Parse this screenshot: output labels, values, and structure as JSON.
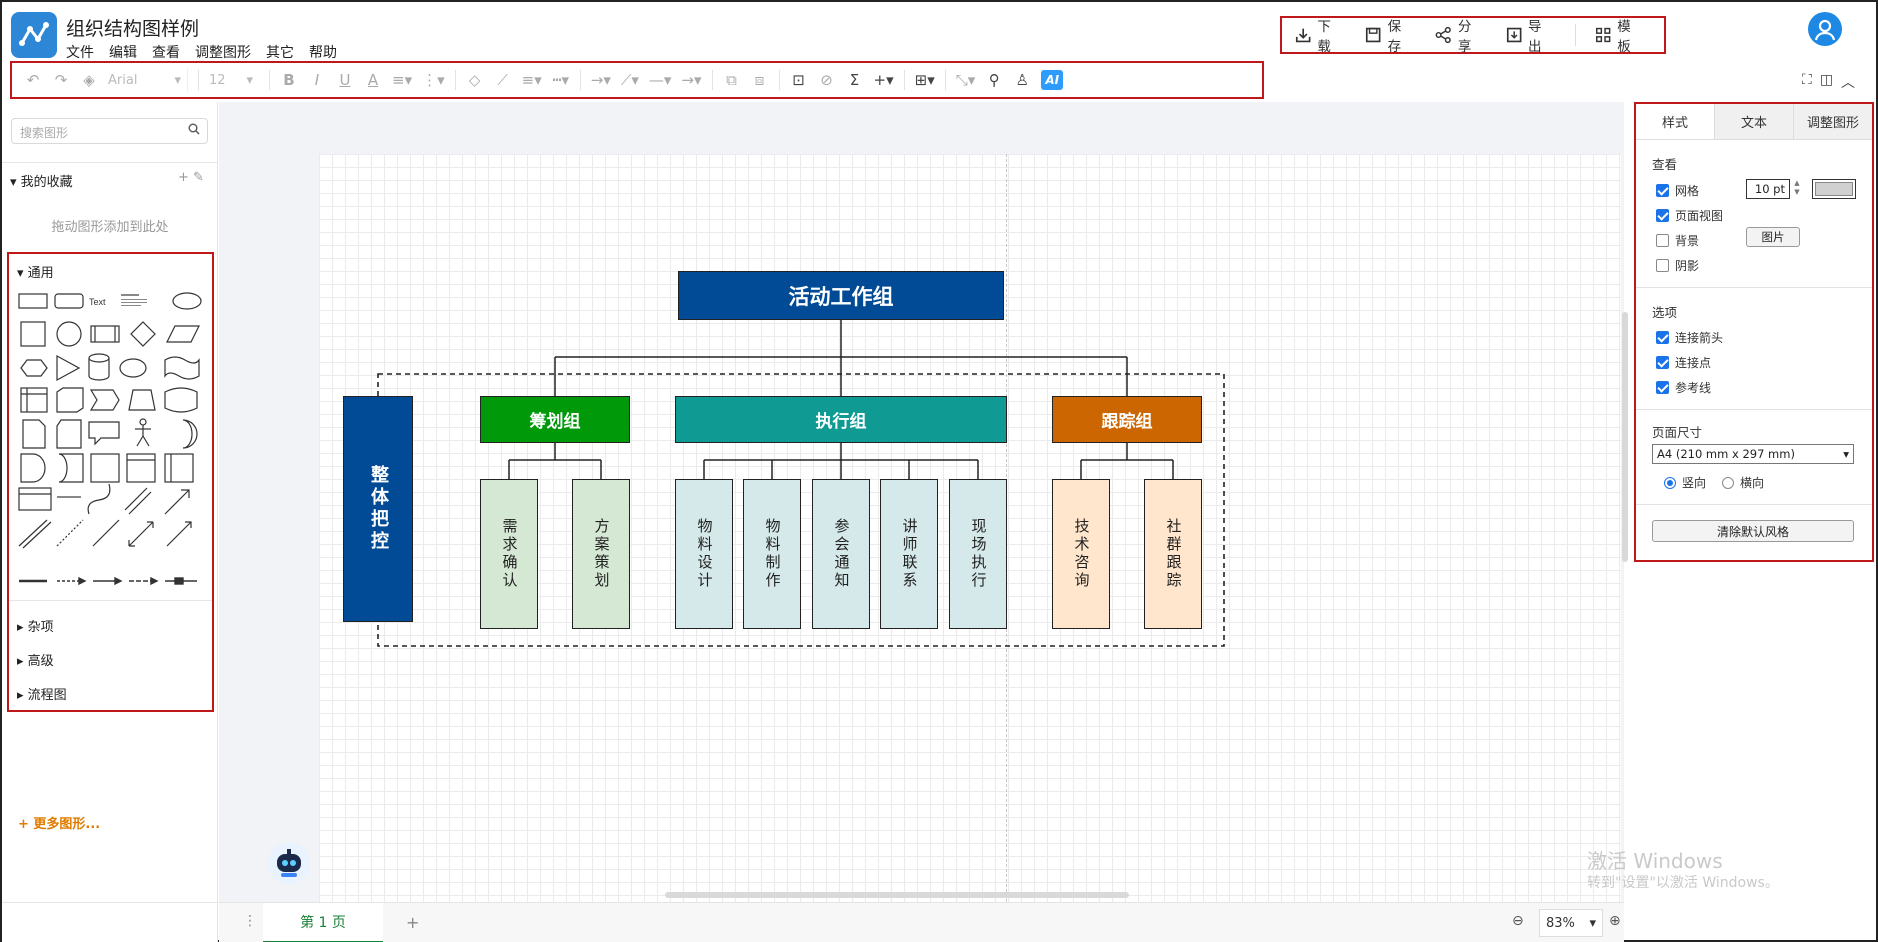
{
  "app": {
    "title": "组织结构图样例",
    "menu": [
      "文件",
      "编辑",
      "查看",
      "调整图形",
      "其它",
      "帮助"
    ]
  },
  "actions": {
    "download": "下载",
    "save": "保存",
    "share": "分享",
    "export": "导出",
    "template": "模板"
  },
  "toolbar": {
    "font": "Arial",
    "font_size": "12",
    "ai": "AI"
  },
  "left_panel": {
    "search_placeholder": "搜索图形",
    "favorites": "我的收藏",
    "favorites_hint": "拖动图形添加到此处",
    "general": "通用",
    "shape_text_label": "Text",
    "categories": [
      "杂项",
      "高级",
      "流程图"
    ],
    "more_shapes": "+ 更多图形..."
  },
  "diagram": {
    "root": "活动工作组",
    "side": "整体把控",
    "groups": [
      {
        "name": "筹划组",
        "color": "#00990a",
        "children": [
          "需求确认",
          "方案策划"
        ],
        "child_color": "#d5e8d4"
      },
      {
        "name": "执行组",
        "color": "#0f9a94",
        "children": [
          "物料设计",
          "物料制作",
          "参会通知",
          "讲师联系",
          "现场执行"
        ],
        "child_color": "#d6e9ea"
      },
      {
        "name": "跟踪组",
        "color": "#cc6600",
        "children": [
          "技术咨询",
          "社群跟踪"
        ],
        "child_color": "#ffe6cc"
      }
    ],
    "root_color": "#004a96",
    "side_color": "#004a96"
  },
  "bottom": {
    "page_tab": "第 1 页",
    "zoom": "83%"
  },
  "right_panel": {
    "tabs": [
      "样式",
      "文本",
      "调整图形"
    ],
    "view_section": "查看",
    "grid": "网格",
    "grid_size": "10 pt",
    "page_view": "页面视图",
    "background": "背景",
    "image_button": "图片",
    "shadow": "阴影",
    "options_section": "选项",
    "connect_arrows": "连接箭头",
    "connect_points": "连接点",
    "guides": "参考线",
    "page_size_section": "页面尺寸",
    "page_size": "A4 (210 mm x 297 mm)",
    "portrait": "竖向",
    "landscape": "横向",
    "clear_style": "清除默认风格"
  },
  "watermark": {
    "line1": "激活 Windows",
    "line2": "转到\"设置\"以激活 Windows。"
  }
}
